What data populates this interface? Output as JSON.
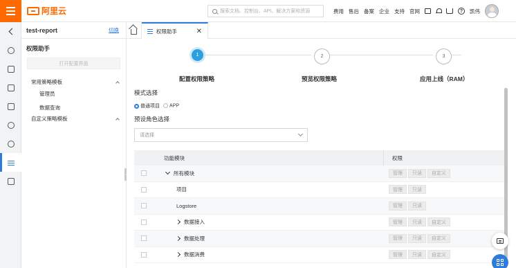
{
  "topbar": {
    "logo_text": "阿里云",
    "search_placeholder": "搜索文档、控制台、API、解决方案和资源",
    "nav": [
      "费用",
      "售后",
      "备案",
      "企业",
      "支持",
      "官网"
    ],
    "user_name": "凯伟",
    "brand_color": "#ff6a00"
  },
  "sidebar": {
    "project_name": "test-report",
    "switch_label": "切换",
    "section_title": "权限助手",
    "open_config_button": "打开配置界面",
    "groups": [
      {
        "label": "常用策略模板",
        "children": [
          "管理员",
          "数据查询"
        ]
      },
      {
        "label": "自定义策略模板",
        "children": []
      }
    ]
  },
  "tabs": {
    "active_label": "权限助手"
  },
  "steps": [
    {
      "number": "1",
      "label": "配置权限策略",
      "state": "active"
    },
    {
      "number": "2",
      "label": "预览权限策略",
      "state": "inactive"
    },
    {
      "number": "3",
      "label": "应用上线（RAM）",
      "state": "inactive"
    }
  ],
  "form": {
    "mode_label": "模式选择",
    "mode_options": [
      "普通项目",
      "APP"
    ],
    "mode_selected": "普通项目",
    "role_label": "预设角色选择",
    "role_placeholder": "请选择"
  },
  "table": {
    "headers": [
      "功能模块",
      "权限"
    ],
    "perm_buttons": [
      "管理",
      "只读",
      "自定义"
    ],
    "rows": [
      {
        "name": "所有模块",
        "expander": "down",
        "perms": [
          "管理",
          "只读",
          "自定义"
        ]
      },
      {
        "name": "项目",
        "expander": "none",
        "perms": [
          "管理",
          "只读"
        ]
      },
      {
        "name": "Logstore",
        "expander": "none",
        "perms": [
          "管理",
          "只读"
        ]
      },
      {
        "name": "数据接入",
        "expander": "right",
        "perms": [
          "管理",
          "只读",
          "自定义"
        ]
      },
      {
        "name": "数据处理",
        "expander": "right",
        "perms": [
          "管理",
          "只读",
          "自定义"
        ]
      },
      {
        "name": "数据消费",
        "expander": "right",
        "perms": [
          "管理",
          "只读",
          "自定义"
        ]
      }
    ]
  },
  "accent_color": "#2d7cdc"
}
